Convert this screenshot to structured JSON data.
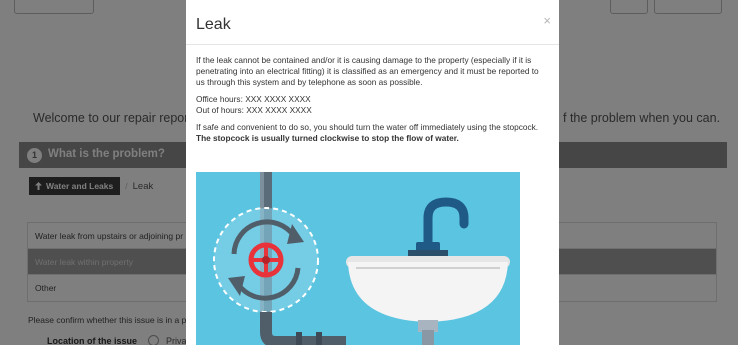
{
  "background": {
    "welcome_text": "Welcome to our repair reporting",
    "welcome_text_right": "f the problem when you can.",
    "step": {
      "number": "1",
      "title": "What is the problem?"
    },
    "breadcrumb": {
      "category": "Water and Leaks",
      "separator": "/",
      "current": "Leak"
    },
    "options": [
      {
        "label": "Water leak from upstairs or adjoining pr"
      },
      {
        "label": "Water leak within property"
      },
      {
        "label": "Other"
      }
    ],
    "confirm_text": "Please confirm whether this issue is in a p",
    "location": {
      "label": "Location of the issue",
      "option": "Privat"
    }
  },
  "modal": {
    "title": "Leak",
    "close_symbol": "×",
    "paragraph1": "If the leak cannot be contained and/or it is causing damage to the property (especially if it is penetrating into an electrical fitting) it is classified as an emergency and it must be reported to us through this system and by telephone as soon as possible.",
    "office_hours": "Office hours: XXX XXXX XXXX",
    "out_of_hours": "Out of hours: XXX XXXX XXXX",
    "paragraph3_plain": "If safe and convenient to do so, you should turn the water off immediately using the stopcock. ",
    "paragraph3_bold": "The stopcock is usually turned clockwise to stop the flow of water."
  },
  "colors": {
    "illustration_bg": "#5bc4e0",
    "pipe": "#5a6b7a",
    "valve": "#e8333a",
    "tap": "#1e5a85",
    "sink": "#f4f4f4"
  }
}
